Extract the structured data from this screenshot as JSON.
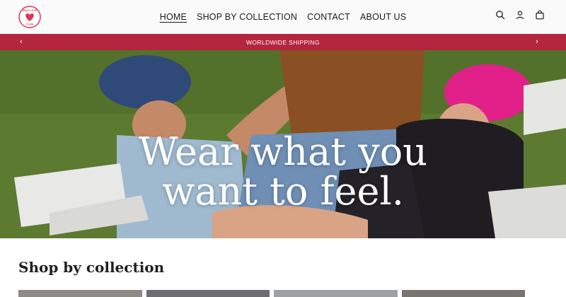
{
  "brand": {
    "logo_text": "SELF LOVE CLUB",
    "logo_icon": "heart-icon",
    "color": "#d83a55"
  },
  "nav": {
    "items": [
      {
        "label": "HOME",
        "active": true
      },
      {
        "label": "SHOP BY COLLECTION",
        "active": false
      },
      {
        "label": "CONTACT",
        "active": false
      },
      {
        "label": "ABOUT US",
        "active": false
      }
    ]
  },
  "header_icons": [
    "search-icon",
    "account-icon",
    "cart-icon"
  ],
  "announcement": {
    "text": "WORLDWIDE SHIPPING",
    "background": "#b3263e"
  },
  "hero": {
    "headline_line1": "Wear what you",
    "headline_line2": "want to feel."
  },
  "collections": {
    "title": "Shop by collection"
  }
}
